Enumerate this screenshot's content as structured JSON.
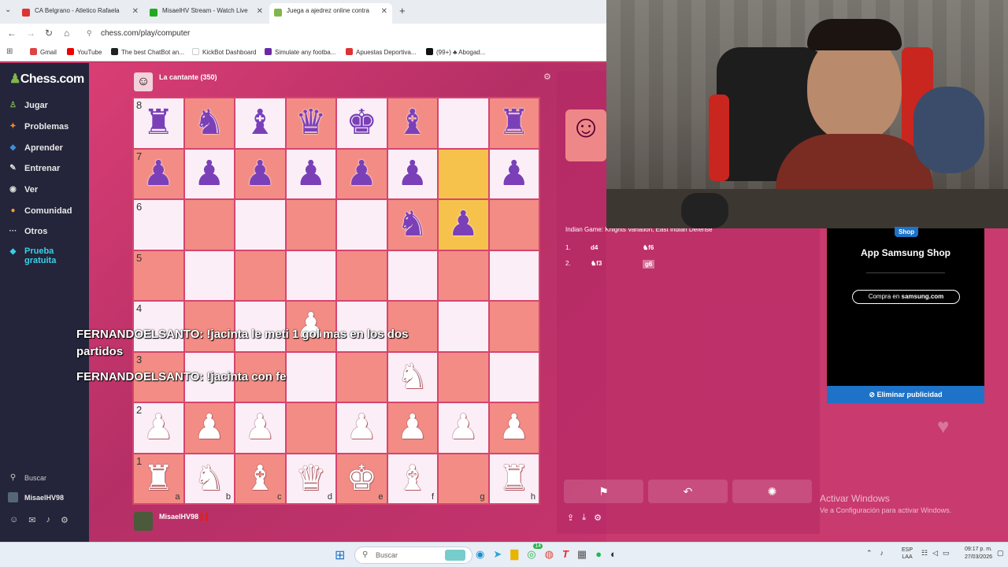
{
  "browser": {
    "tabs": [
      {
        "label": "CA Belgrano - Atletico Rafaela",
        "active": false
      },
      {
        "label": "MisaelHV Stream - Watch Live",
        "active": false
      },
      {
        "label": "Juega a ajedrez online contra",
        "active": true
      }
    ],
    "url": "chess.com/play/computer",
    "bookmarks": [
      "Gmail",
      "YouTube",
      "The best ChatBot an...",
      "KickBot Dashboard",
      "Simulate any footba...",
      "Apuestas Deportiva...",
      "(99+) ♣ Abogad..."
    ]
  },
  "sidebar": {
    "logo": "Chess.com",
    "items": [
      {
        "label": "Jugar",
        "icon": "play-icon",
        "color": "#81b64c"
      },
      {
        "label": "Problemas",
        "icon": "puzzle-icon",
        "color": "#f08a2c"
      },
      {
        "label": "Aprender",
        "icon": "learn-icon",
        "color": "#3b8fd6"
      },
      {
        "label": "Entrenar",
        "icon": "train-icon",
        "color": "#e6e6e6"
      },
      {
        "label": "Ver",
        "icon": "watch-icon",
        "color": "#e6e6e6"
      },
      {
        "label": "Comunidad",
        "icon": "community-icon",
        "color": "#f0a030"
      },
      {
        "label": "Otros",
        "icon": "more-icon",
        "color": "#e6e6e6"
      },
      {
        "label": "Prueba gratuita",
        "icon": "diamond-icon",
        "color": "#3ad0e6"
      }
    ],
    "search": "Buscar",
    "user": "MisaelHV98"
  },
  "game": {
    "opponent": "La cantante (350)",
    "player": "MisaelHV98",
    "files": [
      "a",
      "b",
      "c",
      "d",
      "e",
      "f",
      "g",
      "h"
    ],
    "ranks": [
      "8",
      "7",
      "6",
      "5",
      "4",
      "3",
      "2",
      "1"
    ],
    "board": [
      [
        "bR",
        "bN",
        "bB",
        "bQ",
        "bK",
        "bB",
        "",
        "bR"
      ],
      [
        "bP",
        "bP",
        "bP",
        "bP",
        "bP",
        "bP",
        "",
        "bP"
      ],
      [
        "",
        "",
        "",
        "",
        "",
        "bN",
        "bP",
        ""
      ],
      [
        "",
        "",
        "",
        "",
        "",
        "",
        "",
        ""
      ],
      [
        "",
        "",
        "",
        "wP",
        "",
        "",
        "",
        ""
      ],
      [
        "",
        "",
        "",
        "",
        "",
        "wN",
        "",
        ""
      ],
      [
        "wP",
        "wP",
        "wP",
        "",
        "wP",
        "wP",
        "wP",
        "wP"
      ],
      [
        "wR",
        "wN",
        "wB",
        "wQ",
        "wK",
        "wB",
        "",
        "wR"
      ]
    ],
    "highlight": [
      [
        1,
        6
      ],
      [
        2,
        6
      ]
    ],
    "opening": "Indian Game: Knights Variation, East Indian Defense",
    "moves": [
      {
        "n": "1.",
        "w": "d4",
        "b": "♞f6"
      },
      {
        "n": "2.",
        "w": "♞f3",
        "b": "g6"
      }
    ]
  },
  "chat": [
    {
      "text": "FERNANDOELSANTO: !jacinta le meti 1 gol mas en los dos partidos"
    },
    {
      "text": "FERNANDOELSANTO: !jacinta con fe"
    }
  ],
  "ad": {
    "badge": "Shop",
    "title": "App Samsung Shop",
    "cta": "Compra en",
    "brand": "samsung.com",
    "remove": "Eliminar publicidad"
  },
  "watermark": {
    "title": "Activar Windows",
    "subtitle": "Ve a Configuración para activar Windows."
  },
  "taskbar": {
    "search": "Buscar",
    "lang": "ESP",
    "lang2": "LAA",
    "time": "09:17 p. m.",
    "date": "27/03/2026",
    "badge": "14"
  },
  "colors": {
    "accent": "#81b64c",
    "board_dark": "#f28c84",
    "board_light": "#fbeef7",
    "highlight": "#f6c24c",
    "ad_button": "#1e73c8"
  }
}
